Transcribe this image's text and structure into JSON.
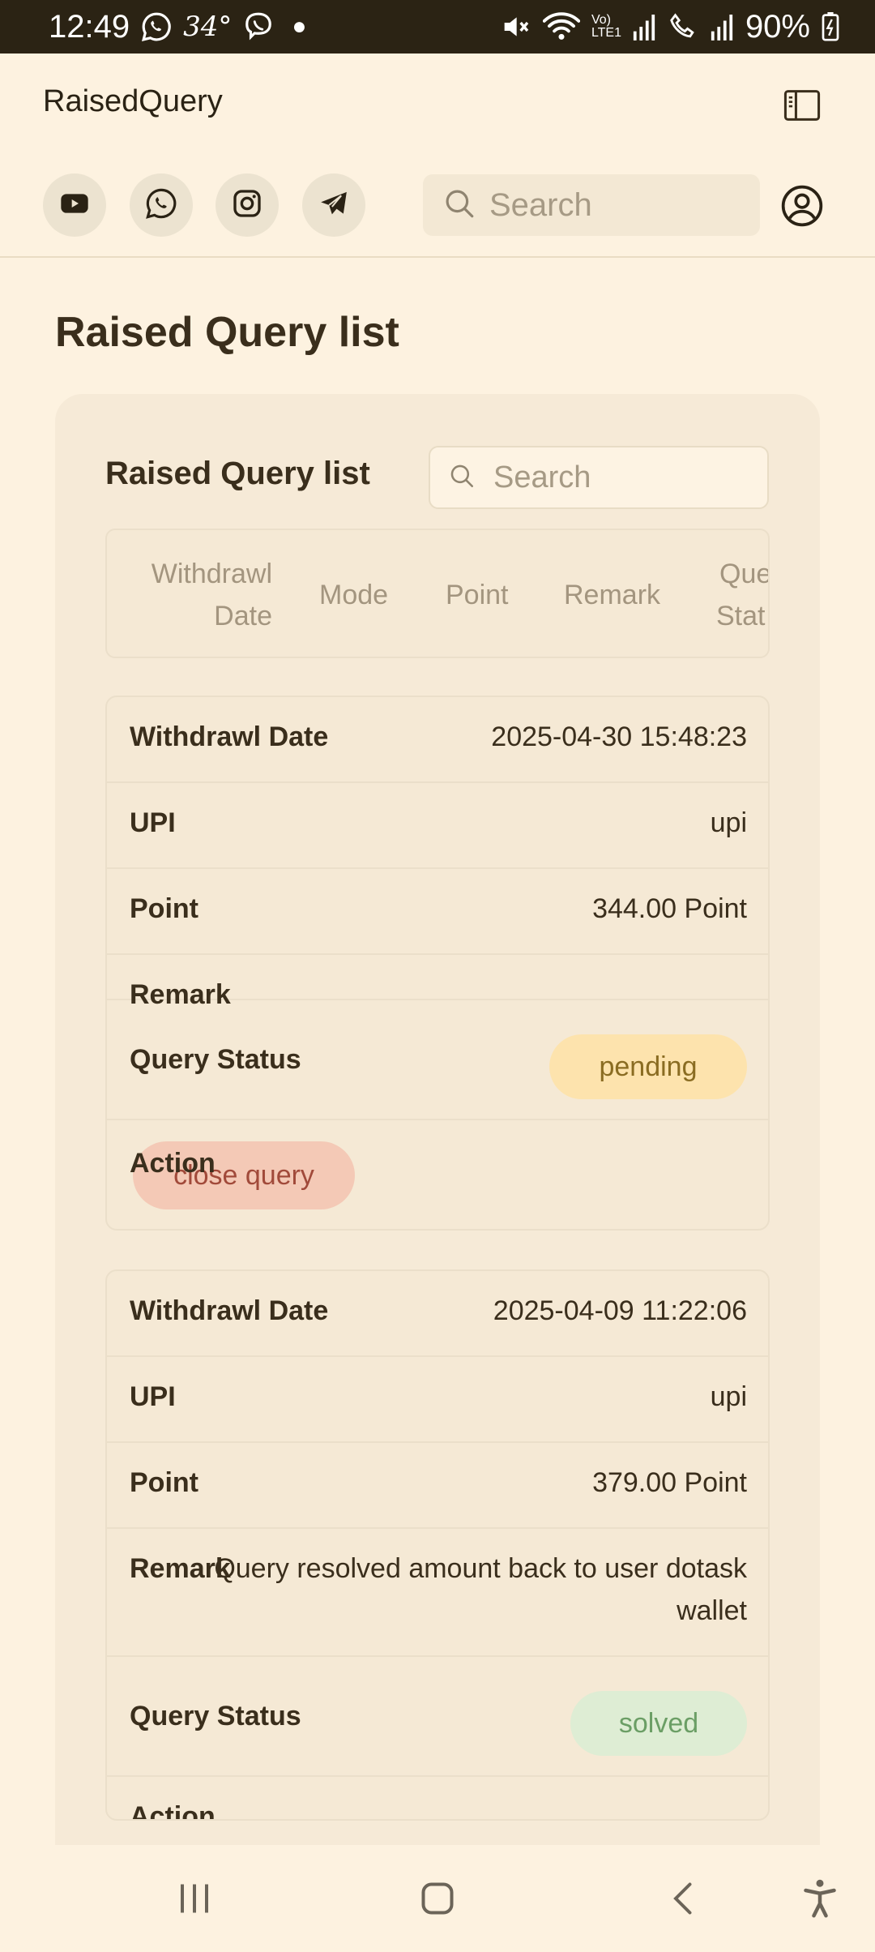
{
  "status_bar": {
    "time": "12:49",
    "temperature": "34°",
    "network": "Vo) LTE1",
    "battery": "90%"
  },
  "app": {
    "title": "RaisedQuery",
    "search_placeholder": "Search",
    "social_links": [
      "youtube-icon",
      "whatsapp-icon",
      "instagram-icon",
      "telegram-icon"
    ]
  },
  "page": {
    "title": "Raised Query list",
    "card_title": "Raised Query list",
    "card_search_placeholder": "Search"
  },
  "table": {
    "headers": {
      "withdrawl": "Withdrawl",
      "date": "Date",
      "mode": "Mode",
      "point": "Point",
      "remark": "Remark",
      "query": "Que",
      "status": "Stat"
    }
  },
  "labels": {
    "withdrawl_date": "Withdrawl Date",
    "mode": "UPI",
    "point": "Point",
    "remark": "Remark",
    "query_status": "Query Status",
    "action": "Action"
  },
  "records": [
    {
      "withdrawl_date": "2025-04-30 15:48:23",
      "mode": "upi",
      "point": "344.00 Point",
      "remark": "",
      "status": "pending",
      "action": "close query"
    },
    {
      "withdrawl_date": "2025-04-09 11:22:06",
      "mode": "upi",
      "point": "379.00 Point",
      "remark_line1": "Query resolved amount back to user dotask",
      "remark_line2": "wallet",
      "status": "solved"
    }
  ],
  "colors": {
    "background": "#fdf2e0",
    "status_bar": "#2b2314",
    "pending_badge": "#fde3ad",
    "solved_badge": "#deedd4",
    "close_button": "#f4c9b6"
  }
}
